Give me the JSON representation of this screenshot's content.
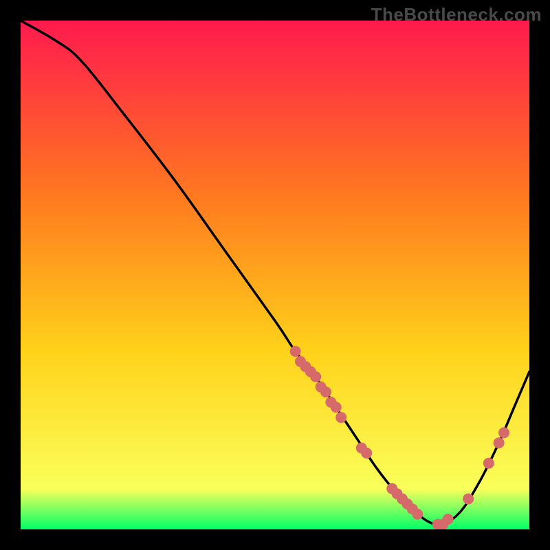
{
  "watermark": {
    "text": "TheBottleneck.com"
  },
  "colors": {
    "gradient_top": "#ff1a4e",
    "gradient_mid1": "#ff7a1f",
    "gradient_mid2": "#ffd21a",
    "gradient_mid3": "#faff5a",
    "gradient_bottom": "#00ff66",
    "curve": "#000000",
    "marker": "#d66a6a",
    "background": "#000000"
  },
  "chart_data": {
    "type": "line",
    "title": "",
    "xlabel": "",
    "ylabel": "",
    "xlim": [
      0,
      100
    ],
    "ylim": [
      0,
      100
    ],
    "legend": false,
    "grid": false,
    "series": [
      {
        "name": "bottleneck-curve",
        "x": [
          0,
          7,
          12,
          20,
          30,
          40,
          50,
          54,
          58,
          62,
          66,
          70,
          74,
          78,
          82,
          86,
          90,
          94,
          97,
          100
        ],
        "y": [
          100,
          96,
          92,
          82,
          69,
          55,
          41,
          35,
          30,
          24,
          18,
          12,
          7,
          3,
          1,
          3,
          9,
          17,
          24,
          31
        ]
      }
    ],
    "markers": [
      {
        "series": "bottleneck-curve",
        "x": 54,
        "y": 35
      },
      {
        "series": "bottleneck-curve",
        "x": 55,
        "y": 33
      },
      {
        "series": "bottleneck-curve",
        "x": 56,
        "y": 32
      },
      {
        "series": "bottleneck-curve",
        "x": 57,
        "y": 31
      },
      {
        "series": "bottleneck-curve",
        "x": 58,
        "y": 30
      },
      {
        "series": "bottleneck-curve",
        "x": 59,
        "y": 28
      },
      {
        "series": "bottleneck-curve",
        "x": 60,
        "y": 27
      },
      {
        "series": "bottleneck-curve",
        "x": 61,
        "y": 25
      },
      {
        "series": "bottleneck-curve",
        "x": 62,
        "y": 24
      },
      {
        "series": "bottleneck-curve",
        "x": 63,
        "y": 22
      },
      {
        "series": "bottleneck-curve",
        "x": 67,
        "y": 16
      },
      {
        "series": "bottleneck-curve",
        "x": 68,
        "y": 15
      },
      {
        "series": "bottleneck-curve",
        "x": 73,
        "y": 8
      },
      {
        "series": "bottleneck-curve",
        "x": 74,
        "y": 7
      },
      {
        "series": "bottleneck-curve",
        "x": 75,
        "y": 6
      },
      {
        "series": "bottleneck-curve",
        "x": 76,
        "y": 5
      },
      {
        "series": "bottleneck-curve",
        "x": 77,
        "y": 4
      },
      {
        "series": "bottleneck-curve",
        "x": 78,
        "y": 3
      },
      {
        "series": "bottleneck-curve",
        "x": 82,
        "y": 1
      },
      {
        "series": "bottleneck-curve",
        "x": 83,
        "y": 1
      },
      {
        "series": "bottleneck-curve",
        "x": 84,
        "y": 2
      },
      {
        "series": "bottleneck-curve",
        "x": 88,
        "y": 6
      },
      {
        "series": "bottleneck-curve",
        "x": 92,
        "y": 13
      },
      {
        "series": "bottleneck-curve",
        "x": 94,
        "y": 17
      },
      {
        "series": "bottleneck-curve",
        "x": 95,
        "y": 19
      }
    ]
  }
}
